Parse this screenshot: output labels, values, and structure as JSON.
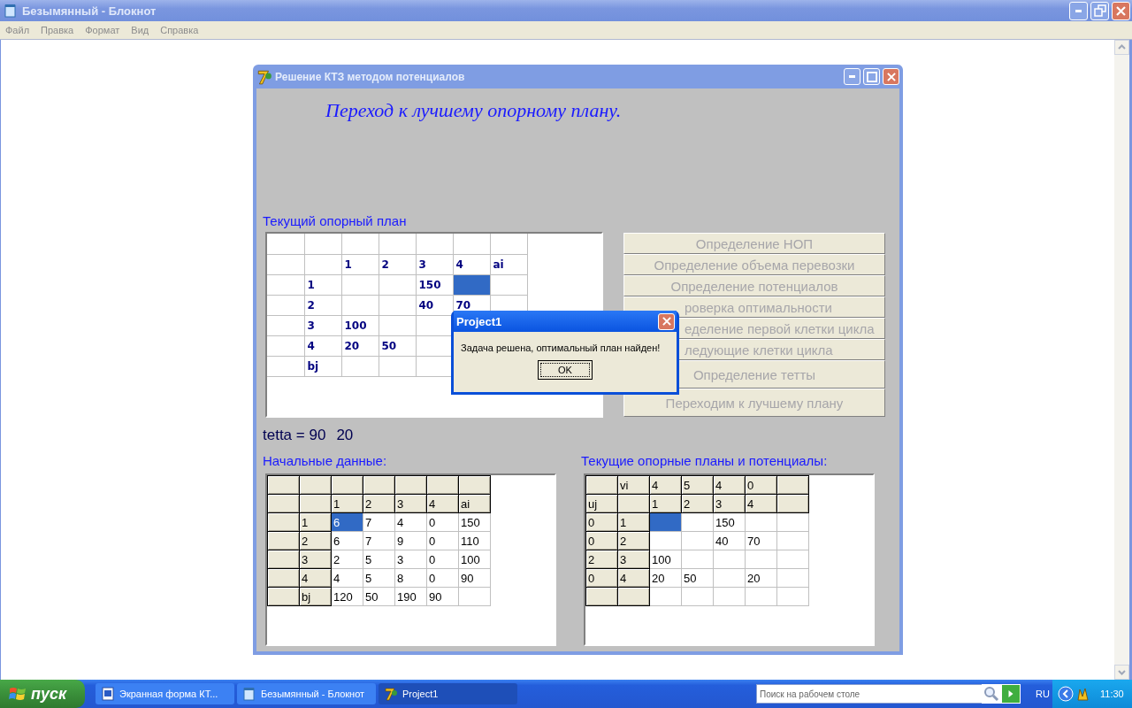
{
  "notepad": {
    "title": "Безымянный - Блокнот",
    "menu": [
      "Файл",
      "Правка",
      "Формат",
      "Вид",
      "Справка"
    ]
  },
  "app_window": {
    "title": "Решение КТЗ методом потенциалов",
    "heading": "Переход к лучшему опорному плану.",
    "current_plan": {
      "label": "Текущий опорный план",
      "kind": "plain",
      "rows": [
        [
          {
            "selected": false
          },
          {
            "selected": false
          },
          {
            "selected": false
          },
          {
            "selected": false
          },
          {
            "selected": false
          },
          {
            "selected": false
          },
          {
            "selected": false
          }
        ],
        [
          {
            "selected": false
          },
          {
            "selected": false
          },
          {
            "text": "1",
            "selected": false
          },
          {
            "text": "2",
            "selected": false
          },
          {
            "text": "3",
            "selected": false
          },
          {
            "text": "4",
            "selected": false
          },
          {
            "text": "ai",
            "selected": false
          }
        ],
        [
          {
            "selected": false
          },
          {
            "text": "1",
            "selected": false
          },
          {
            "selected": false
          },
          {
            "selected": false
          },
          {
            "text": "150",
            "selected": false
          },
          {
            "selected": true
          },
          {
            "selected": false
          }
        ],
        [
          {
            "selected": false
          },
          {
            "text": "2",
            "selected": false
          },
          {
            "selected": false
          },
          {
            "selected": false
          },
          {
            "text": "40",
            "selected": false
          },
          {
            "text": "70",
            "selected": false
          },
          {
            "selected": false
          }
        ],
        [
          {
            "selected": false
          },
          {
            "text": "3",
            "selected": false
          },
          {
            "text": "100",
            "selected": false
          },
          {
            "selected": false
          },
          {
            "selected": false
          }
        ],
        [
          {
            "selected": false
          },
          {
            "text": "4",
            "selected": false
          },
          {
            "text": "20",
            "selected": false
          },
          {
            "text": "50",
            "selected": false
          },
          {
            "selected": false
          }
        ],
        [
          {
            "selected": false
          },
          {
            "text": "bj",
            "selected": false
          },
          {
            "selected": false
          },
          {
            "selected": false
          },
          {
            "selected": false
          }
        ]
      ]
    },
    "steps": [
      {
        "label": "Определение НОП",
        "disabled": true,
        "partial": false
      },
      {
        "label": "Определение объема перевозки",
        "disabled": true,
        "partial": false
      },
      {
        "label": "Определение потенциалов",
        "disabled": true,
        "partial": false
      },
      {
        "label": "роверка оптимальности",
        "disabled": true,
        "partial": true
      },
      {
        "label": "еделение первой клетки цикла",
        "disabled": true,
        "partial": true
      },
      {
        "label": "ледующие клетки цикла",
        "disabled": true,
        "partial": true
      },
      {
        "label": "Определение тетты",
        "disabled": true,
        "partial": false
      },
      {
        "label": "Переходим к лучшему плану",
        "disabled": true,
        "partial": false
      }
    ],
    "tetta": {
      "label": "tetta = 90",
      "value": "20"
    },
    "initial_data": {
      "label": "Начальные данные:",
      "kind": "fixed",
      "rows": [
        [
          {
            "selected": false
          },
          {
            "selected": false
          },
          {
            "selected": false
          },
          {
            "selected": false
          },
          {
            "selected": false
          },
          {
            "selected": false
          },
          {
            "selected": false
          }
        ],
        [
          {
            "selected": false
          },
          {
            "selected": false
          },
          {
            "text": "1",
            "selected": false
          },
          {
            "text": "2",
            "selected": false
          },
          {
            "text": "3",
            "selected": false
          },
          {
            "text": "4",
            "selected": false
          },
          {
            "text": "ai",
            "selected": false
          }
        ],
        [
          {
            "selected": false
          },
          {
            "text": "1",
            "selected": false
          },
          {
            "text": "6",
            "selected": true
          },
          {
            "text": "7",
            "selected": false
          },
          {
            "text": "4",
            "selected": false
          },
          {
            "text": "0",
            "selected": false
          },
          {
            "text": "150",
            "selected": false
          }
        ],
        [
          {
            "selected": false
          },
          {
            "text": "2",
            "selected": false
          },
          {
            "text": "6",
            "selected": false
          },
          {
            "text": "7",
            "selected": false
          },
          {
            "text": "9",
            "selected": false
          },
          {
            "text": "0",
            "selected": false
          },
          {
            "text": "110",
            "selected": false
          }
        ],
        [
          {
            "selected": false
          },
          {
            "text": "3",
            "selected": false
          },
          {
            "text": "2",
            "selected": false
          },
          {
            "text": "5",
            "selected": false
          },
          {
            "text": "3",
            "selected": false
          },
          {
            "text": "0",
            "selected": false
          },
          {
            "text": "100",
            "selected": false
          }
        ],
        [
          {
            "selected": false
          },
          {
            "text": "4",
            "selected": false
          },
          {
            "text": "4",
            "selected": false
          },
          {
            "text": "5",
            "selected": false
          },
          {
            "text": "8",
            "selected": false
          },
          {
            "text": "0",
            "selected": false
          },
          {
            "text": "90",
            "selected": false
          }
        ],
        [
          {
            "selected": false
          },
          {
            "text": "bj",
            "selected": false
          },
          {
            "text": "120",
            "selected": false
          },
          {
            "text": "50",
            "selected": false
          },
          {
            "text": "190",
            "selected": false
          },
          {
            "text": "90",
            "selected": false
          },
          {
            "selected": false
          }
        ]
      ]
    },
    "plans": {
      "label": "Текущие опорные планы и потенциалы:",
      "kind": "fixed",
      "rows": [
        [
          {
            "selected": false
          },
          {
            "text": "vi",
            "selected": false
          },
          {
            "text": "4",
            "selected": false
          },
          {
            "text": "5",
            "selected": false
          },
          {
            "text": "4",
            "selected": false
          },
          {
            "text": "0",
            "selected": false
          },
          {
            "selected": false
          }
        ],
        [
          {
            "text": "uj",
            "selected": false
          },
          {
            "selected": false
          },
          {
            "text": "1",
            "selected": false
          },
          {
            "text": "2",
            "selected": false
          },
          {
            "text": "3",
            "selected": false
          },
          {
            "text": "4",
            "selected": false
          },
          {
            "selected": false
          }
        ],
        [
          {
            "text": "0",
            "selected": false
          },
          {
            "text": "1",
            "selected": false
          },
          {
            "selected": true
          },
          {
            "selected": false
          },
          {
            "text": "150",
            "selected": false
          },
          {
            "selected": false
          },
          {
            "selected": false
          }
        ],
        [
          {
            "text": "0",
            "selected": false
          },
          {
            "text": "2",
            "selected": false
          },
          {
            "selected": false
          },
          {
            "selected": false
          },
          {
            "text": "40",
            "selected": false
          },
          {
            "text": "70",
            "selected": false
          },
          {
            "selected": false
          }
        ],
        [
          {
            "text": "2",
            "selected": false
          },
          {
            "text": "3",
            "selected": false
          },
          {
            "text": "100",
            "selected": false
          },
          {
            "selected": false
          },
          {
            "selected": false
          },
          {
            "selected": false
          },
          {
            "selected": false
          }
        ],
        [
          {
            "text": "0",
            "selected": false
          },
          {
            "text": "4",
            "selected": false
          },
          {
            "text": "20",
            "selected": false
          },
          {
            "text": "50",
            "selected": false
          },
          {
            "selected": false
          },
          {
            "text": "20",
            "selected": false
          },
          {
            "selected": false
          }
        ],
        [
          {
            "selected": false
          },
          {
            "selected": false
          },
          {
            "selected": false
          },
          {
            "selected": false
          },
          {
            "selected": false
          },
          {
            "selected": false
          },
          {
            "selected": false
          }
        ]
      ]
    }
  },
  "dialog": {
    "title": "Project1",
    "message": "Задача решена, оптимальный план найден!",
    "button": "OK"
  },
  "taskbar": {
    "start": "пуск",
    "tasks": [
      {
        "label": "Экранная форма КТ...",
        "selected": false
      },
      {
        "label": "Безымянный - Блокнот",
        "selected": false
      },
      {
        "label": "Project1",
        "selected": true
      }
    ],
    "search": {
      "placeholder": "Поиск на рабочем столе"
    },
    "language": "RU",
    "clock": "11:30"
  }
}
